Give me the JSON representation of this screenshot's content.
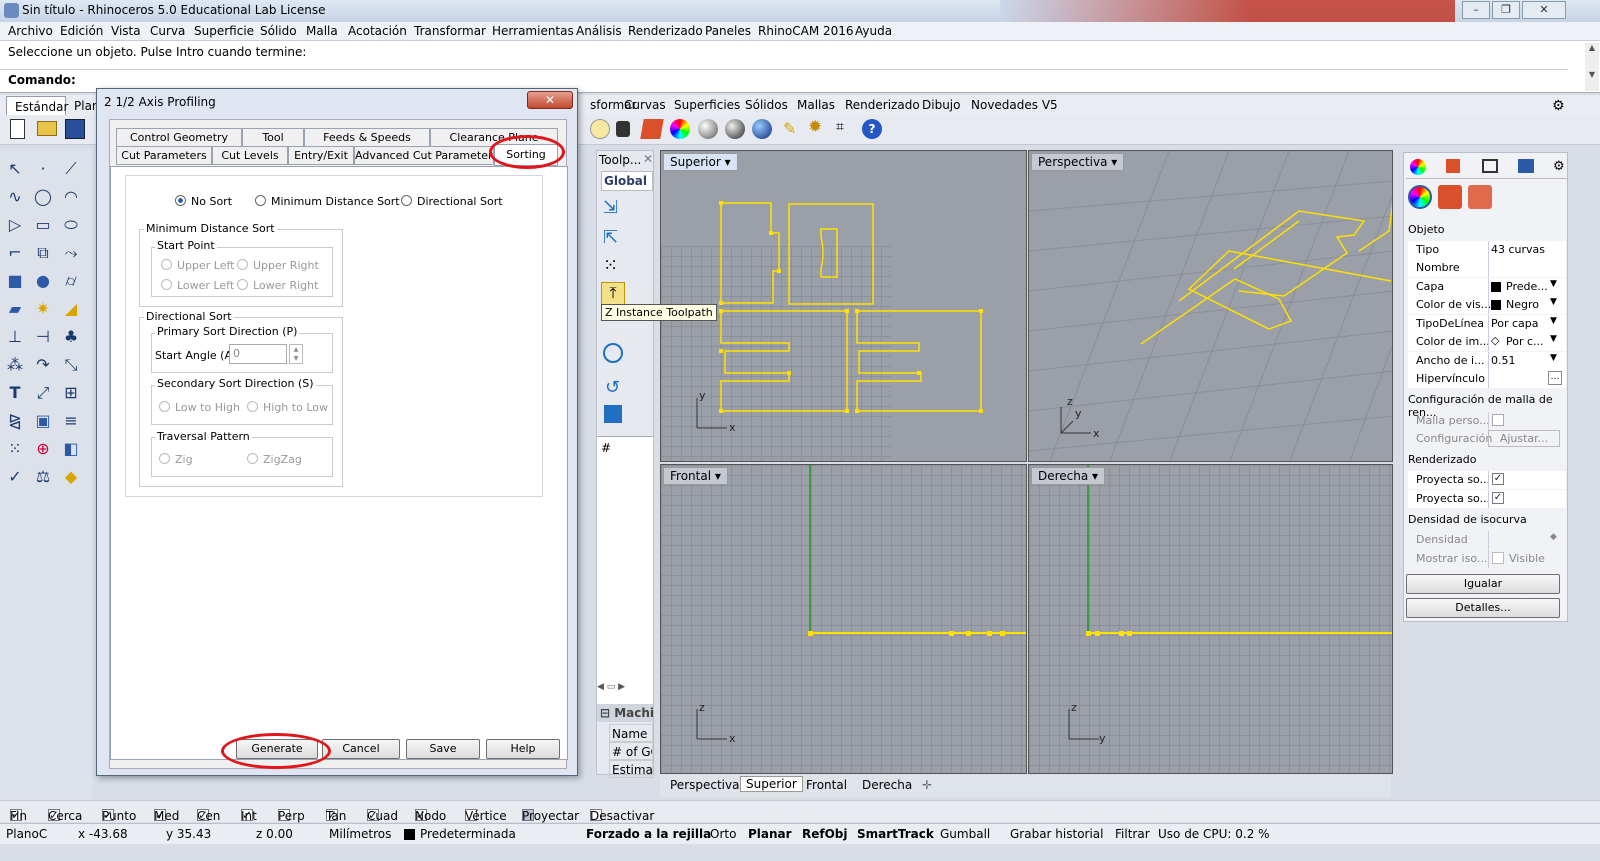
{
  "window": {
    "title": "Sin título - Rhinoceros 5.0 Educational Lab License"
  },
  "menu": [
    "Archivo",
    "Edición",
    "Vista",
    "Curva",
    "Superficie",
    "Sólido",
    "Malla",
    "Acotación",
    "Transformar",
    "Herramientas",
    "Análisis",
    "Renderizado",
    "Paneles",
    "RhinoCAM 2016",
    "Ayuda"
  ],
  "command": {
    "prompt": "Seleccione un objeto. Pulse Intro cuando termine:",
    "label": "Comando:"
  },
  "toolbar_tabs": [
    "Estándar",
    "Plan",
    "sformar",
    "Curvas",
    "Superficies",
    "Sólidos",
    "Mallas",
    "Renderizado",
    "Dibujo",
    "Novedades V5"
  ],
  "dialog": {
    "title": "2 1/2 Axis Profiling",
    "tabs_row1": [
      "Control Geometry",
      "Tool",
      "Feeds & Speeds",
      "Clearance Plane"
    ],
    "tabs_row2": [
      "Cut Parameters",
      "Cut Levels",
      "Entry/Exit",
      "Advanced Cut Parameters",
      "Sorting"
    ],
    "sort": {
      "no_sort": "No Sort",
      "min_dist": "Minimum Distance Sort",
      "directional": "Directional Sort"
    },
    "min_group": {
      "label": "Minimum Distance Sort",
      "start_point": "Start Point",
      "ul": "Upper Left",
      "ur": "Upper Right",
      "ll": "Lower Left",
      "lr": "Lower Right"
    },
    "dir_group": {
      "label": "Directional Sort",
      "primary": "Primary Sort Direction (P)",
      "start_angle_label": "Start Angle (A)",
      "start_angle_value": "0",
      "secondary": "Secondary Sort Direction (S)",
      "low_high": "Low to High",
      "high_low": "High to Low",
      "traversal": "Traversal Pattern",
      "zig": "Zig",
      "zigzag": "ZigZag"
    },
    "buttons": {
      "generate": "Generate",
      "cancel": "Cancel",
      "save": "Save",
      "help": "Help"
    }
  },
  "palette": {
    "title": "Toolp...",
    "global": "Global E",
    "tooltip": "Z Instance Toolpath",
    "hash": "#",
    "machine": "Machin",
    "rows": [
      "Name",
      "# of GC",
      "Estimat"
    ]
  },
  "viewports": {
    "top": "Superior",
    "persp": "Perspectiva",
    "front": "Frontal",
    "right": "Derecha"
  },
  "viewport_tabs": [
    "Perspectiva",
    "Superior",
    "Frontal",
    "Derecha"
  ],
  "props": {
    "section_obj": "Objeto",
    "rows": [
      {
        "k": "Tipo",
        "v": "43 curvas"
      },
      {
        "k": "Nombre",
        "v": ""
      },
      {
        "k": "Capa",
        "v": "Prede..."
      },
      {
        "k": "Color de vis...",
        "v": "Negro"
      },
      {
        "k": "TipoDeLínea",
        "v": "Por capa"
      },
      {
        "k": "Color de im...",
        "v": "Por c..."
      },
      {
        "k": "Ancho de i...",
        "v": "0.51"
      },
      {
        "k": "Hipervínculo",
        "v": ""
      }
    ],
    "mesh_section": "Configuración de malla de ren...",
    "mesh_rows": [
      {
        "k": "Malla perso...",
        "v": ""
      },
      {
        "k": "Configuración",
        "v": "Ajustar..."
      }
    ],
    "render_section": "Renderizado",
    "render_rows": [
      {
        "k": "Proyecta so..."
      },
      {
        "k": "Proyecta so..."
      }
    ],
    "iso_section": "Densidad de isocurva",
    "iso_rows": [
      {
        "k": "Densidad",
        "v": ""
      },
      {
        "k": "Mostrar iso...",
        "v": "Visible"
      }
    ],
    "match": "Igualar",
    "details": "Detalles..."
  },
  "osnap": [
    "Fin",
    "Cerca",
    "Punto",
    "Med",
    "Cen",
    "Int",
    "Perp",
    "Tan",
    "Cuad",
    "Nodo",
    "Vértice",
    "Proyectar",
    "Desactivar"
  ],
  "osnap_checked": [
    true,
    true,
    true,
    true,
    true,
    true,
    false,
    true,
    true,
    true,
    false,
    false,
    false
  ],
  "status": {
    "plane": "PlanoC",
    "x": "x -43.68",
    "y": "y 35.43",
    "z": "z 0.00",
    "units": "Milímetros",
    "layer": "Predeterminada",
    "grid": "Forzado a la rejilla",
    "ortho": "Orto",
    "planar": "Planar",
    "osnap": "RefObj",
    "smarttrack": "SmartTrack",
    "gumball": "Gumball",
    "history": "Grabar historial",
    "filter": "Filtrar",
    "cpu": "Uso de CPU: 0.2 %"
  }
}
